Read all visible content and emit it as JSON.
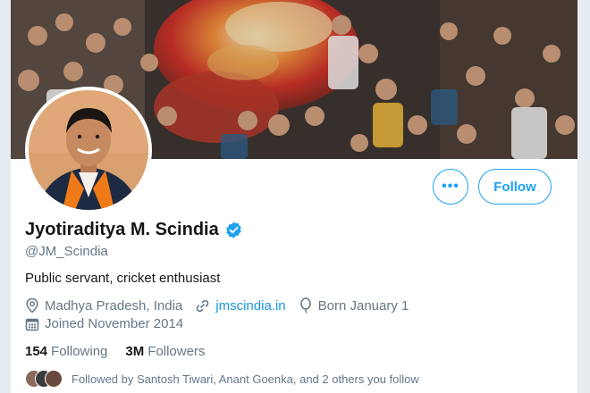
{
  "profile": {
    "display_name": "Jyotiraditya M. Scindia",
    "handle": "@JM_Scindia",
    "bio": "Public servant, cricket enthusiast",
    "location": "Madhya Pradesh, India",
    "website": "jmscindia.in",
    "birthday": "Born January 1",
    "joined": "Joined November 2014",
    "verified": true
  },
  "stats": {
    "following_count": "154",
    "following_label": "Following",
    "followers_count": "3M",
    "followers_label": "Followers"
  },
  "actions": {
    "more_label": "•••",
    "follow_label": "Follow"
  },
  "followed_by": {
    "text": "Followed by Santosh Tiwari, Anant Goenka, and 2 others you follow"
  },
  "icons": {
    "verified": "verified-badge-icon",
    "location": "location-pin-icon",
    "link": "link-icon",
    "birthday": "balloon-icon",
    "joined": "calendar-icon",
    "more": "more-options-icon"
  },
  "colors": {
    "accent": "#1da1f2",
    "link": "#1b95e0",
    "secondary_text": "#657786",
    "primary_text": "#14171a"
  }
}
